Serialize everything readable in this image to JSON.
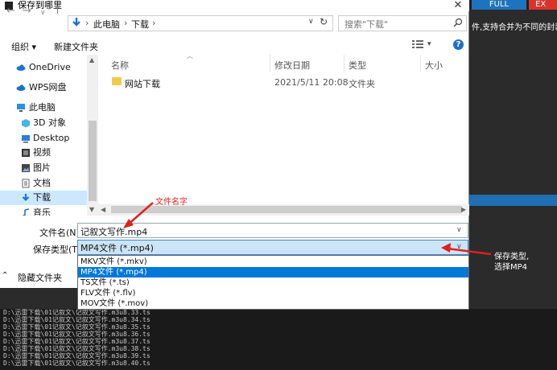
{
  "window": {
    "title": "保存到哪里",
    "close_label": "✕"
  },
  "background_app": {
    "full_button": "FULL",
    "exit_button": "EX",
    "description": "件,支持合并为不同的封装",
    "terminal_lines": [
      "D:\\迅雷下载\\01记叙文\\记叙文写作.m3u8.33.ts",
      "D:\\迅雷下载\\01记叙文\\记叙文写作.m3u8.34.ts",
      "D:\\迅雷下载\\01记叙文\\记叙文写作.m3u8.35.ts",
      "D:\\迅雷下载\\01记叙文\\记叙文写作.m3u8.36.ts",
      "D:\\迅雷下载\\01记叙文\\记叙文写作.m3u8.37.ts",
      "D:\\迅雷下载\\01记叙文\\记叙文写作.m3u8.38.ts",
      "D:\\迅雷下载\\01记叙文\\记叙文写作.m3u8.39.ts",
      "D:\\迅雷下载\\01记叙文\\记叙文写作.m3u8.40.ts"
    ]
  },
  "navbar": {
    "back": "←",
    "forward": "→",
    "dropdown": "∨",
    "up": "↑",
    "crumbs": [
      "此电脑",
      "下载"
    ],
    "sep": "›",
    "refresh": "↻",
    "search_placeholder": "搜索\"下载\""
  },
  "toolbar": {
    "organize": "组织 ▾",
    "new_folder": "新建文件夹",
    "view_dd": "▾",
    "help": "?"
  },
  "nav_pane": {
    "items": [
      {
        "label": "OneDrive",
        "icon": "cloud-icon"
      },
      {
        "label": "WPS网盘",
        "icon": "cloud-icon"
      },
      {
        "label": "此电脑",
        "icon": "computer-icon"
      },
      {
        "label": "3D 对象",
        "icon": "cube-icon"
      },
      {
        "label": "Desktop",
        "icon": "desktop-icon"
      },
      {
        "label": "视频",
        "icon": "video-icon"
      },
      {
        "label": "图片",
        "icon": "picture-icon"
      },
      {
        "label": "文档",
        "icon": "document-icon"
      },
      {
        "label": "下载",
        "icon": "download-icon"
      },
      {
        "label": "音乐",
        "icon": "music-icon"
      }
    ]
  },
  "file_list": {
    "columns": [
      "名称",
      "修改日期",
      "类型",
      "大小"
    ],
    "rows": [
      {
        "name": "网站下载",
        "date": "2021/5/11 20:08",
        "type": "文件夹"
      }
    ]
  },
  "form": {
    "filename_label": "文件名(N):",
    "filename_value": "记叙文写作.mp4",
    "filetype_label": "保存类型(T):",
    "filetype_value": "MP4文件 (*.mp4)",
    "options": [
      "MKV文件 (*.mkv)",
      "MP4文件 (*.mp4)",
      "TS文件 (*.ts)",
      "FLV文件 (*.flv)",
      "MOV文件 (*.mov)"
    ],
    "selected_option_index": 1,
    "hide_folders": "隐藏文件夹"
  },
  "annotations": {
    "filename_note": "文件名字",
    "type_note_line1": "保存类型,",
    "type_note_line2": "选择MP4",
    "color": "#e02020"
  }
}
